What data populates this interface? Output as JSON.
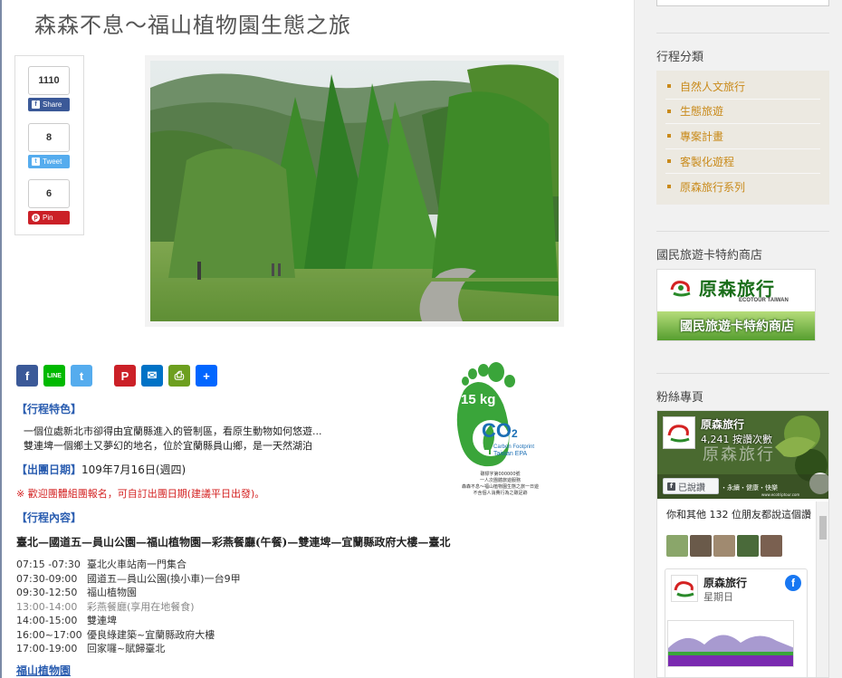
{
  "page": {
    "title": "森森不息～福山植物園生態之旅"
  },
  "share": {
    "facebook": {
      "count": "1110",
      "label": "Share"
    },
    "twitter": {
      "count": "8",
      "label": "Tweet"
    },
    "pinterest": {
      "count": "6",
      "label": "Pin"
    }
  },
  "social_icons": [
    "facebook-icon",
    "line-icon",
    "twitter-icon",
    "pinterest-icon",
    "email-icon",
    "print-icon",
    "more-icon"
  ],
  "social_glyphs": {
    "facebook": "f",
    "line": "LINE",
    "twitter": "t",
    "pinterest": "P",
    "email": "✉",
    "print": "⎙",
    "more": "+"
  },
  "carbon": {
    "weight": "15 kg",
    "co2": "CO",
    "co2_sub": "2",
    "line1": "Carbon Footprint",
    "line2": "Taiwan EPA",
    "caption1": "碳標字第000000號",
    "caption2": "一人次團體旅遊服務",
    "caption3": "森森不息～福山植物園生態之旅一日遊",
    "caption4": "不含個人消費行為之碳足跡"
  },
  "trip": {
    "features_heading": "【行程特色】",
    "features_lines": [
      "一個位處新北市卻得由宜蘭縣進入的管制區，看原生動物如何悠遊...",
      "雙連埤一個鄉土又夢幻的地名，位於宜蘭縣員山鄉，是一天然湖泊"
    ],
    "date_label": "【出團日期】",
    "date_value": "109年7月16日(週四)",
    "notice": "※ 歡迎團體組團報名，可自訂出團日期(建議平日出發)。",
    "content_heading": "【行程內容】",
    "route": "臺北—國道五—員山公園—福山植物園—彩燕餐廳(午餐)—雙連埤—宜蘭縣政府大樓—臺北",
    "schedule": [
      {
        "time": "07:15 -07:30",
        "desc": "臺北火車站南一門集合",
        "grey": false
      },
      {
        "time": "07:30-09:00",
        "desc": "國道五—員山公園(換小車)一台9甲",
        "grey": false
      },
      {
        "time": "09:30-12:50",
        "desc": "福山植物園",
        "grey": false
      },
      {
        "time": "13:00-14:00",
        "desc": "彩燕餐廳(享用在地餐食)",
        "grey": true
      },
      {
        "time": "14:00-15:00",
        "desc": "雙連埤",
        "grey": false
      },
      {
        "time": "16:00~17:00",
        "desc": "優良綠建築~宜蘭縣政府大樓",
        "grey": false
      },
      {
        "time": "17:00-19:00",
        "desc": "回家囉~賦歸臺北",
        "grey": false
      }
    ],
    "bottom_link": "福山植物園"
  },
  "sidebar": {
    "category_title": "行程分類",
    "categories": [
      "自然人文旅行",
      "生態旅遊",
      "專案計畫",
      "客製化遊程",
      "原森旅行系列"
    ],
    "card_title": "國民旅遊卡特約商店",
    "banner_brand": "原森旅行",
    "banner_sub": "ECOTOUR TAIWAN",
    "banner_store": "國民旅遊卡特約商店",
    "fans_title": "粉絲專頁",
    "fb_page_name": "原森旅行",
    "fb_likes": "4,241 按讚次數",
    "fb_cover_text": "原森旅行",
    "fb_cover_tagline": "・永續・健康・快樂",
    "fb_cover_url": "www.ecotriptour.com",
    "fb_like_btn": "已說讚",
    "fb_friends": "你和其他 132 位朋友都說這個讚",
    "fb_post_name": "原森旅行",
    "fb_post_day": "星期日"
  },
  "colors": {
    "accent_blue": "#2a5db0",
    "notice_red": "#d42222",
    "category_orange": "#c98a1a",
    "facebook": "#3b5998",
    "twitter": "#55acee",
    "pinterest": "#cb2027",
    "line": "#00b900",
    "email": "#0072c6",
    "print": "#6d9f1f",
    "more": "#0166ff"
  }
}
